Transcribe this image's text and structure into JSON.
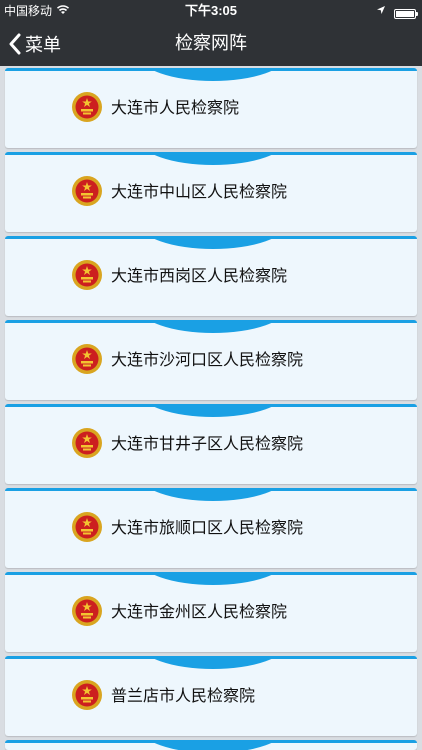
{
  "status_bar": {
    "carrier": "中国移动",
    "time": "下午3:05"
  },
  "nav": {
    "back_label": "菜单",
    "title": "检察网阵"
  },
  "list": {
    "items": [
      {
        "label": "大连市人民检察院"
      },
      {
        "label": "大连市中山区人民检察院"
      },
      {
        "label": "大连市西岗区人民检察院"
      },
      {
        "label": "大连市沙河口区人民检察院"
      },
      {
        "label": "大连市甘井子区人民检察院"
      },
      {
        "label": "大连市旅顺口区人民检察院"
      },
      {
        "label": "大连市金州区人民检察院"
      },
      {
        "label": "普兰店市人民检察院"
      }
    ]
  },
  "colors": {
    "bar": "#2f3236",
    "accent": "#1aa0e4",
    "card": "#eef7fd"
  }
}
